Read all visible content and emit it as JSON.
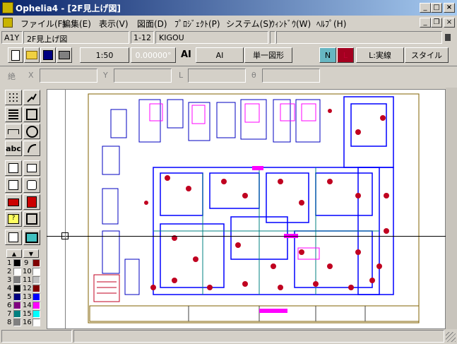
{
  "window": {
    "title": "Ophelia4 - [2F見上げ図]",
    "app_icon": "app-icon"
  },
  "menu": {
    "items": [
      "ファイル(F)",
      "編集(E)",
      "表示(V)",
      "図面(D)",
      "ﾌﾟﾛｼﾞｪｸﾄ(P)",
      "システム(S)",
      "ｳｨﾝﾄﾞｳ(W)",
      "ﾍﾙﾌﾟ(H)"
    ]
  },
  "status_top": {
    "sheet": "A1Y",
    "drawing": "2F見上げ図",
    "layer": "1-12",
    "layer_name": "KIGOU"
  },
  "toolbar": {
    "scale": "1:50",
    "angle": "0.00000°",
    "ai_icon_label": "AI",
    "ai_button": "AI",
    "single_shape": "単一図形",
    "n_button": "N",
    "l_button": "L",
    "line_type": "L:実線",
    "style": "スタイル"
  },
  "coords": {
    "abs_label": "絶",
    "x_label": "X",
    "y_label": "Y",
    "l_label": "L",
    "theta_label": "θ"
  },
  "palette": {
    "left_numbers": [
      "1",
      "2",
      "3",
      "4",
      "5",
      "6",
      "7",
      "8"
    ],
    "right_numbers": [
      "9",
      "10",
      "11",
      "12",
      "13",
      "14",
      "15",
      "16"
    ],
    "left_colors": [
      "#000000",
      "#ffffff",
      "#808080",
      "#000000",
      "#000080",
      "#800080",
      "#008080",
      "#808080"
    ],
    "right_colors": [
      "#800000",
      "#ffffff",
      "#c0c0c0",
      "#800000",
      "#0000ff",
      "#ff00ff",
      "#00ffff",
      "#ffffff"
    ]
  }
}
